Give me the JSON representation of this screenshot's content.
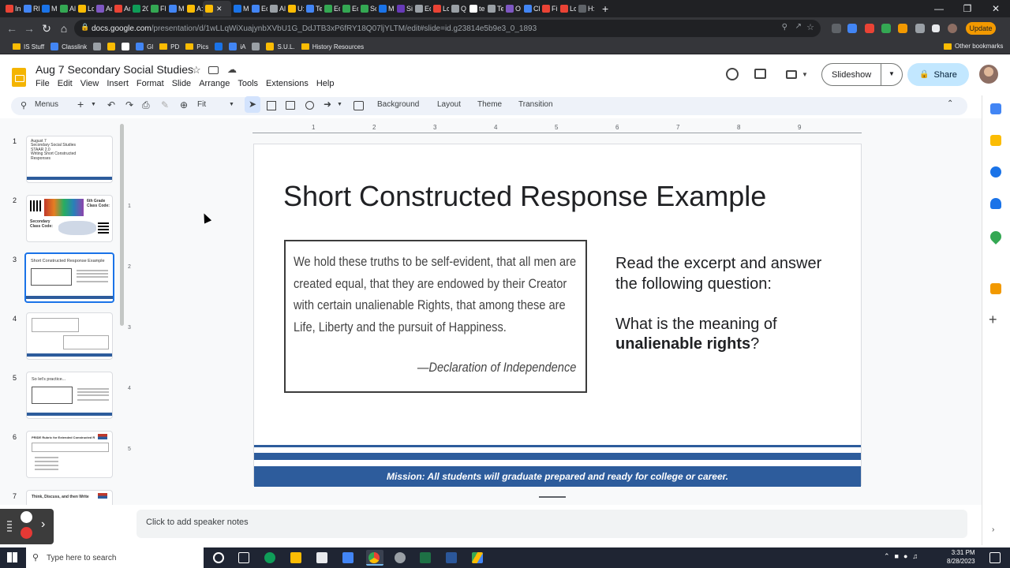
{
  "browser": {
    "tabs": [
      "In",
      "RF",
      "M",
      "Al",
      "Lo",
      "Ac",
      "Ac",
      "20",
      "Fl",
      "M",
      "A:",
      "",
      "M",
      "Ec",
      "Al",
      "U:",
      "Te",
      "Ec",
      "Ec",
      "Sc",
      "M",
      "Si",
      "Ec",
      "Lc",
      "Q",
      "te",
      "Te",
      "O",
      "Cl",
      "Fi",
      "Lc",
      "H:"
    ],
    "active_tab_index": 11,
    "new_tab": "+",
    "url_host": "docs.google.com",
    "url_path": "/presentation/d/1wLLqWiXuajynbXVbU1G_DdJTB3xP6fRY18Q07ljYLTM/edit#slide=id.g23814e5b9e3_0_1893",
    "update_label": "Update",
    "bookmarks": [
      "IS Stuff",
      "Classlink",
      "",
      "",
      "",
      "Gl",
      "PD",
      "Pics",
      "",
      "iA",
      "",
      "S.U.L.",
      "History Resources"
    ],
    "other_bookmarks": "Other bookmarks"
  },
  "app": {
    "title": "Aug 7 Secondary Social Studies",
    "menu": [
      "File",
      "Edit",
      "View",
      "Insert",
      "Format",
      "Slide",
      "Arrange",
      "Tools",
      "Extensions",
      "Help"
    ],
    "slideshow_label": "Slideshow",
    "share_label": "Share"
  },
  "toolbar": {
    "menus_label": "Menus",
    "zoom_label": "Fit",
    "background_label": "Background",
    "layout_label": "Layout",
    "theme_label": "Theme",
    "transition_label": "Transition"
  },
  "ruler": {
    "top": [
      "1",
      "2",
      "3",
      "4",
      "5",
      "6",
      "7",
      "8",
      "9"
    ],
    "left": [
      "1",
      "2",
      "3",
      "4",
      "5"
    ]
  },
  "filmstrip": {
    "numbers": [
      "1",
      "2",
      "3",
      "4",
      "5",
      "6",
      "7"
    ],
    "slide1_lines": [
      "August 7",
      "Secondary Social Studies",
      "STAAR 2.0",
      "Writing Short Constructed",
      "Responses"
    ],
    "slide2_texts": [
      "6th Grade Class Code:",
      "Secondary Class Code:"
    ],
    "slide3_title": "Short Constructed Response Example",
    "slide5_title": "So let's practice...",
    "slide6_title": "PRIDE Rubric for Extended Constructed Response",
    "slide7_title": "Think, Discuss, and then Write",
    "selected_index": 2
  },
  "slide": {
    "title": "Short Constructed Response Example",
    "quote": "We hold these truths to be self-evident, that all men are created equal, that they are endowed by their Creator with certain unalienable Rights, that among these are Life, Liberty and the pursuit of Happiness.",
    "attribution": "—Declaration of Independence",
    "prompt_line1": "Read the excerpt and answer the following question:",
    "prompt_line2_prefix": "What is the meaning of",
    "prompt_line2_bold": "unalienable rights",
    "prompt_line2_suffix": "?",
    "mission": "Mission: All students will graduate prepared and ready for college or career."
  },
  "notes": {
    "placeholder": "Click to add speaker notes"
  },
  "taskbar": {
    "search_placeholder": "Type here to search",
    "time": "3:31 PM",
    "date": "8/28/2023"
  },
  "colors": {
    "accent": "#1a73e8",
    "slide_band": "#2d5c9c",
    "share_bg": "#c2e7ff",
    "docs_yellow": "#f4b400"
  }
}
